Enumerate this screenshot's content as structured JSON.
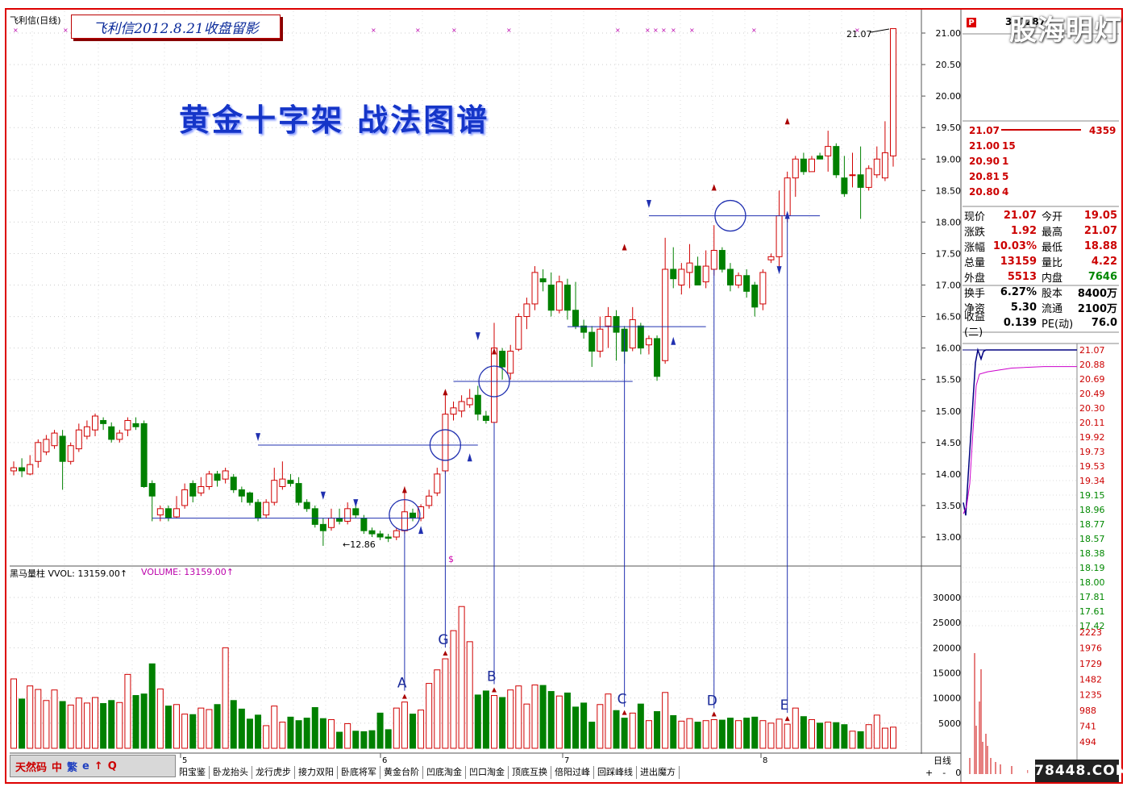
{
  "stock_name": "飞利信(日线)",
  "title_box": "飞利信2012.8.21收盘留影",
  "big_title": "黄金十字架 战法图谱",
  "watermark_top": "股海明灯",
  "stock_code": "300287",
  "p_badge": "P",
  "volume_label_1": "黑马量柱  VVOL: 13159.00↑",
  "volume_label_2": "VOLUME: 13159.00↑",
  "price_callouts": {
    "high": "21.07",
    "low": "←12.86",
    "dollar": "$"
  },
  "price_axis": [
    "21.00",
    "20.50",
    "20.00",
    "19.50",
    "19.00",
    "18.50",
    "18.00",
    "17.50",
    "17.00",
    "16.50",
    "16.00",
    "15.50",
    "15.00",
    "14.50",
    "14.00",
    "13.50",
    "13.00"
  ],
  "volume_axis": [
    "30000",
    "25000",
    "20000",
    "15000",
    "10000",
    "5000"
  ],
  "date_labels": [
    "5",
    "6",
    "7",
    "8"
  ],
  "point_labels": [
    "A",
    "G",
    "B",
    "C",
    "D",
    "E"
  ],
  "order_book": [
    {
      "price": "21.07",
      "qty": "4359"
    },
    {
      "price": "21.00",
      "qty": "15"
    },
    {
      "price": "20.90",
      "qty": "1"
    },
    {
      "price": "20.81",
      "qty": "5"
    },
    {
      "price": "20.80",
      "qty": "4"
    }
  ],
  "quote": [
    {
      "l1": "现价",
      "v1": "21.07",
      "l2": "今开",
      "v2": "19.05"
    },
    {
      "l1": "涨跌",
      "v1": "1.92",
      "l2": "最高",
      "v2": "21.07"
    },
    {
      "l1": "涨幅",
      "v1": "10.03%",
      "l2": "最低",
      "v2": "18.88"
    },
    {
      "l1": "总量",
      "v1": "13159",
      "l2": "量比",
      "v2": "4.22"
    },
    {
      "l1": "外盘",
      "v1": "5513",
      "l2": "内盘",
      "v2": "7646"
    },
    {
      "l1": "换手",
      "v1": "6.27%",
      "l2": "股本",
      "v2": "8400万"
    },
    {
      "l1": "净资",
      "v1": "5.30",
      "l2": "流通",
      "v2": "2100万"
    },
    {
      "l1": "收益(二)",
      "v1": "0.139",
      "l2": "PE(动)",
      "v2": "76.0"
    }
  ],
  "intraday_axis": [
    "21.07",
    "20.88",
    "20.69",
    "20.49",
    "20.30",
    "20.11",
    "19.92",
    "19.73",
    "19.53",
    "19.34",
    "19.15",
    "18.96",
    "18.77",
    "18.57",
    "18.38",
    "18.19",
    "18.00",
    "17.81",
    "17.61",
    "17.42"
  ],
  "intraday_vol_axis": [
    "2223",
    "1976",
    "1729",
    "1482",
    "1235",
    "988",
    "741",
    "494"
  ],
  "controls": [
    "天然码",
    "中",
    "繁",
    "e",
    "↑",
    "Q"
  ],
  "tabs": [
    "阳宝鉴",
    "卧龙抬头",
    "龙行虎步",
    "接力双阳",
    "卧底将军",
    "黄金台阶",
    "凹底淘金",
    "凹口淘金",
    "顶底互换",
    "倍阳过峰",
    "回踩峰线",
    "进出魔方"
  ],
  "daily_label": "日线",
  "zoom": [
    "+",
    "-",
    "0"
  ],
  "watermark_bottom": "178448.COM",
  "colors": {
    "up": "#d00000",
    "down": "#008000",
    "line": "#2030b0",
    "frame": "#d00000"
  }
}
